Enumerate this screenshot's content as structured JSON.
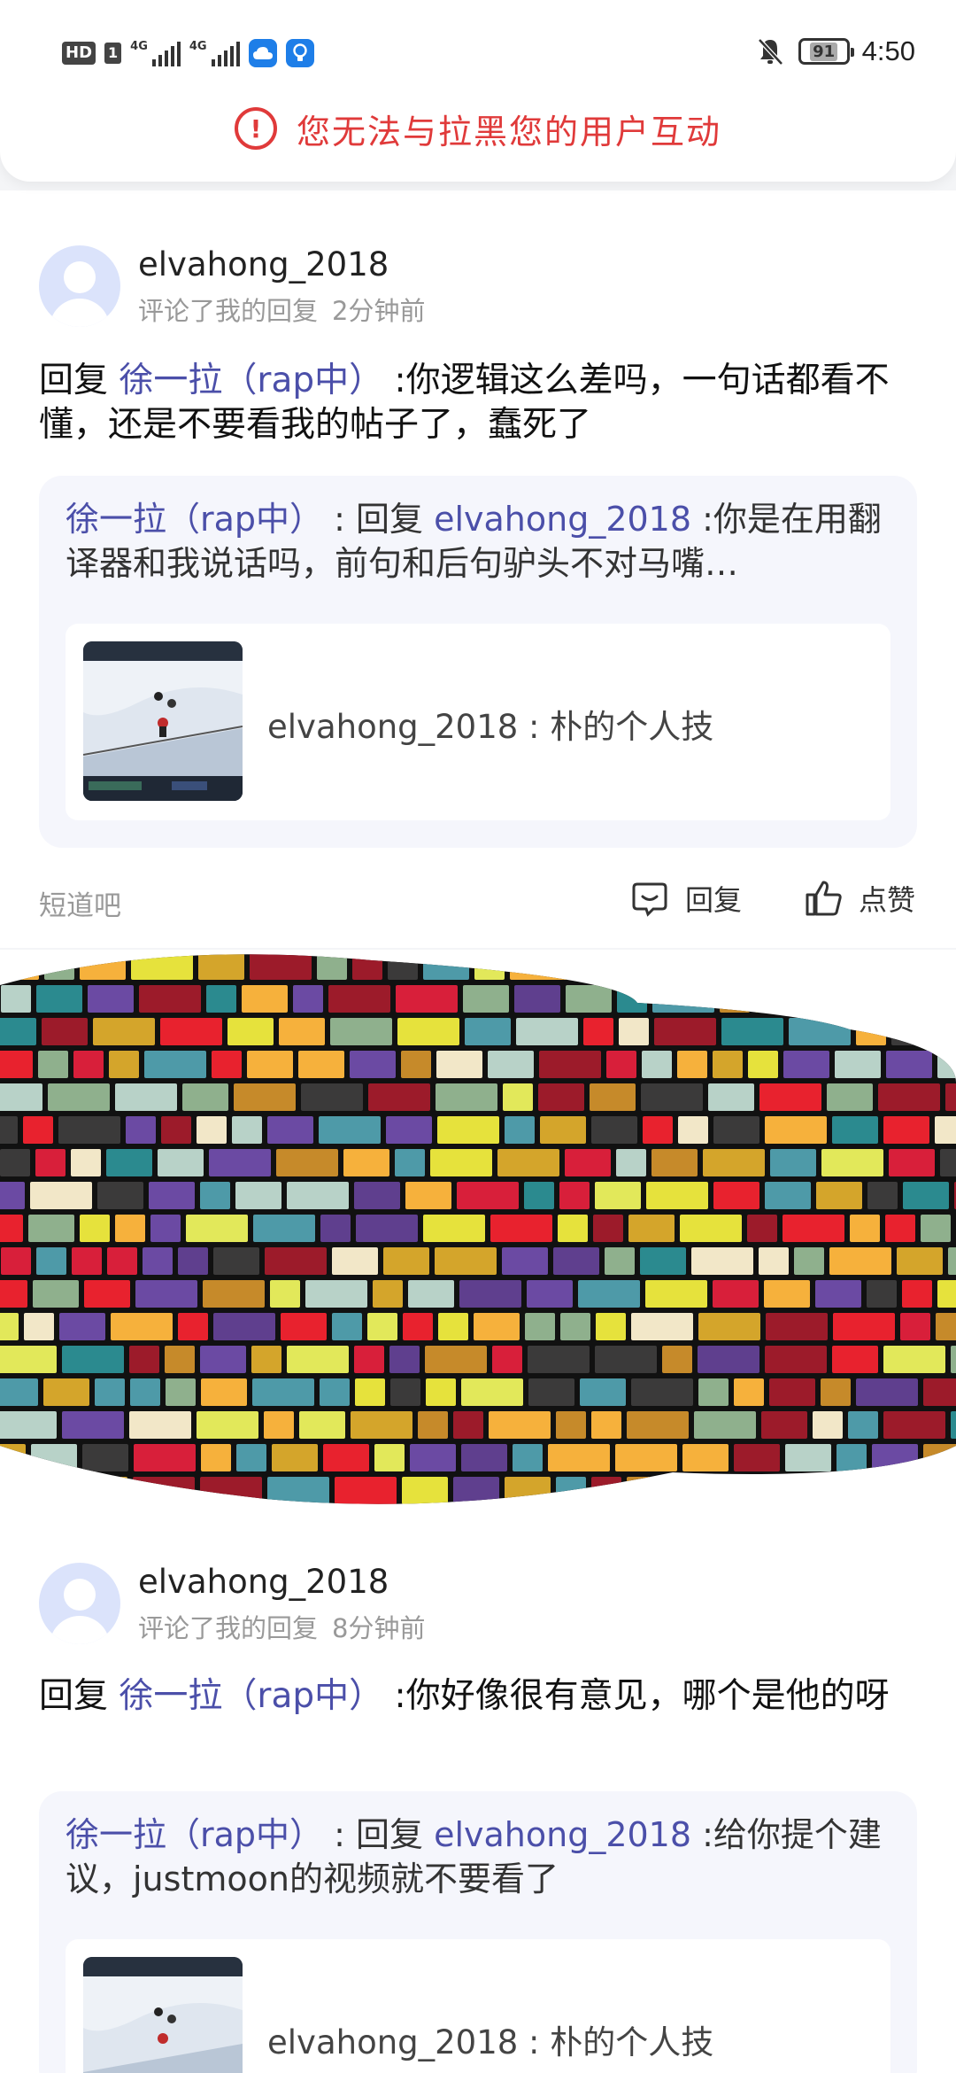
{
  "status_bar": {
    "hd": "HD",
    "sim": "1",
    "net1": "4G",
    "net2": "4G",
    "battery": "91",
    "time": "4:50"
  },
  "banner": {
    "text": "您无法与拉黑您的用户互动",
    "icon": "exclamation-circle-icon",
    "color": "#e03a3a"
  },
  "comments": [
    {
      "username": "elvahong_2018",
      "meta_action": "评论了我的回复",
      "time_ago": "2分钟前",
      "reply_prefix": "回复 ",
      "reply_to": "徐一拉（rap中）",
      "reply_body": " :你逻辑这么差吗，一句话都看不懂，还是不要看我的帖子了，蠢死了",
      "quote_author": "徐一拉（rap中）",
      "quote_mid": " : 回复 ",
      "quote_target": "elvahong_2018",
      "quote_body": " :你是在用翻译器和我说话吗，前句和后句驴头不对马嘴…",
      "post_title": "elvahong_2018 : 朴的个人技",
      "forum": "短道吧",
      "reply_label": "回复",
      "like_label": "点赞"
    },
    {
      "username": "elvahong_2018",
      "meta_action": "评论了我的回复",
      "time_ago": "8分钟前",
      "reply_prefix": "回复 ",
      "reply_to": "徐一拉（rap中）",
      "reply_body": " :你好像很有意见，哪个是他的呀",
      "quote_author": "徐一拉（rap中）",
      "quote_mid": " : 回复 ",
      "quote_target": "elvahong_2018",
      "quote_body": " :给你提个建议，justmoon的视频就不要看了",
      "post_title": "elvahong_2018 : 朴的个人技"
    }
  ],
  "colors": {
    "link": "#4b4fa9",
    "quote_bg": "#f5f6fc",
    "avatar_bg": "#dbe3fb"
  }
}
